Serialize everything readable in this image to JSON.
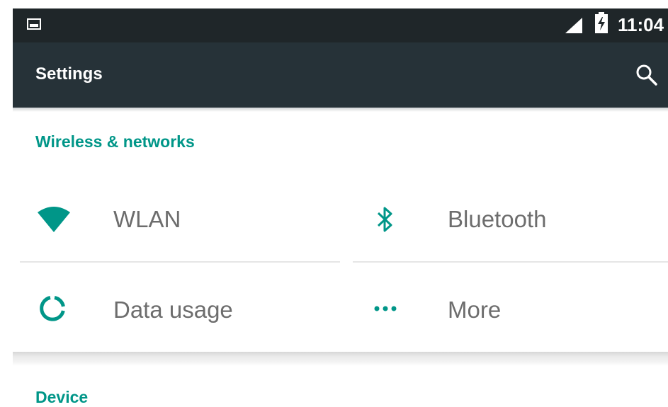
{
  "status_bar": {
    "time": "11:04",
    "icons": [
      "image-notification-icon",
      "cellular-signal-icon",
      "battery-charging-icon"
    ]
  },
  "toolbar": {
    "title": "Settings",
    "search_icon": "search-icon"
  },
  "sections": [
    {
      "header": "Wireless & networks",
      "tiles": [
        {
          "label": "WLAN",
          "icon": "wifi-icon"
        },
        {
          "label": "Bluetooth",
          "icon": "bluetooth-icon"
        },
        {
          "label": "Data usage",
          "icon": "data-usage-icon"
        },
        {
          "label": "More",
          "icon": "more-icon"
        }
      ]
    },
    {
      "header": "Device",
      "tiles": []
    }
  ],
  "colors": {
    "status_bar": "#1f2629",
    "toolbar": "#263238",
    "accent": "#009688",
    "label": "#6d6d6d"
  }
}
